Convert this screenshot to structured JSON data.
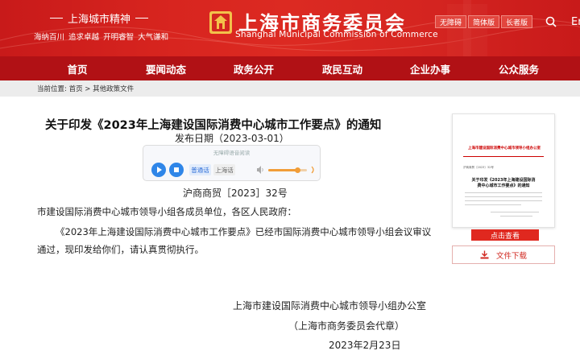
{
  "header": {
    "spirit_title": "上海城市精神",
    "spirit_items": [
      "海纳百川",
      "追求卓越",
      "开明睿智",
      "大气谦和"
    ],
    "site_title": "上海市商务委员会",
    "site_subtitle": "Shanghai Municipal Commission of Commerce",
    "tools": [
      "无障碍",
      "简体版",
      "长者版"
    ],
    "lang": "En",
    "colors": {
      "brand_red": "#d8251f",
      "nav_red": "#b11115"
    }
  },
  "nav": {
    "items": [
      "首页",
      "要闻动态",
      "政务公开",
      "政民互动",
      "企业办事",
      "公众服务"
    ]
  },
  "breadcrumb": {
    "prefix": "当前位置:",
    "home": "首页",
    "separator": ">",
    "current": "其他政策文件"
  },
  "article": {
    "title": "关于印发《2023年上海建设国际消费中心城市工作要点》的通知",
    "publish_date": "发布日期（2023-03-01）",
    "doc_number": "沪商商贸［2023］32号",
    "addressee": "市建设国际消费中心城市领导小组各成员单位，各区人民政府：",
    "body": "《2023年上海建设国际消费中心城市工作要点》已经市国际消费中心城市领导小组会议审议通过，现印发给你们，请认真贯彻执行。",
    "signature": {
      "org": "上海市建设国际消费中心城市领导小组办公室",
      "seal": "（上海市商务委员会代章）",
      "date": "2023年2月23日"
    }
  },
  "player": {
    "brand": "无障碍语音阅读",
    "voice_mandarin": "普通话",
    "voice_shanghai": "上海话",
    "volume": 0.75
  },
  "side": {
    "thumb_header": "上海市建设国际消费中心城市领导小组办公室",
    "thumb_doc_no": "沪商商贸〔2023〕32号",
    "thumb_title": "关于印发《2023年上海建设国际消费中心城市工作要点》的通知",
    "view_label": "点击查看",
    "download_label": "文件下载"
  }
}
